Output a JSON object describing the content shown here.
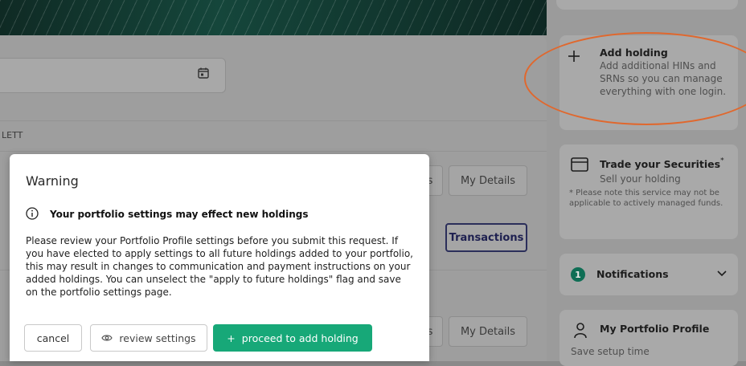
{
  "main": {
    "owner_label": "LETT",
    "buttons": {
      "my_details_1": "My Details",
      "transactions": "Transactions",
      "my_details_2": "My Details",
      "left_partial_1": "s",
      "left_partial_2": "s"
    }
  },
  "sidebar": {
    "add_holding": {
      "title": "Add holding",
      "text": "Add additional HINs and SRNs so you can manage everything with one login."
    },
    "trade": {
      "title": "Trade your Securities",
      "title_mark": "*",
      "text": "Sell your holding",
      "note": "* Please note this service may not be applicable to actively managed funds."
    },
    "notifications": {
      "count": "1",
      "label": "Notifications"
    },
    "portfolio_profile": {
      "title": "My Portfolio Profile",
      "text": "Save setup time"
    }
  },
  "modal": {
    "title": "Warning",
    "subtitle": "Your portfolio settings may effect new holdings",
    "body": "Please review your Portfolio Profile settings before you submit this request. If you have elected to apply settings to all future holdings added to your portfolio, this may result in changes to communication and payment instructions on your added holdings. You can unselect the \"apply to future holdings\" flag and save on the portfolio settings page.",
    "cancel_label": "cancel",
    "review_label": "review settings",
    "proceed_label": "proceed to add holding",
    "proceed_prefix": "+"
  },
  "colors": {
    "accent": "#17a878",
    "annotation": "#e0682e",
    "badge": "#0f6e55"
  },
  "icons": [
    "calendar-icon",
    "plus-icon",
    "card-icon",
    "chevron-down-icon",
    "person-icon",
    "info-icon",
    "eye-icon"
  ]
}
